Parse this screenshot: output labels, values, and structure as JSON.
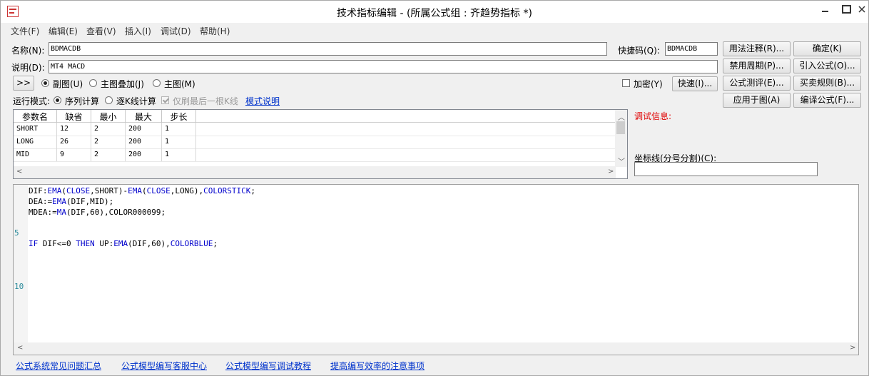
{
  "window": {
    "title": "技术指标编辑 - (所属公式组 : 齐趋势指标 *)"
  },
  "menu": [
    {
      "label": "文件(F)"
    },
    {
      "label": "编辑(E)"
    },
    {
      "label": "查看(V)"
    },
    {
      "label": "插入(I)"
    },
    {
      "label": "调试(D)"
    },
    {
      "label": "帮助(H)"
    }
  ],
  "form": {
    "name_label": "名称(N):",
    "name_value": "BDMACDB",
    "shortcut_label": "快捷码(Q):",
    "shortcut_value": "BDMACDB",
    "desc_label": "说明(D):",
    "desc_value": "MT4 MACD",
    "expand_label": ">>",
    "sub_chart_label": "副图(U)",
    "main_overlay_label": "主图叠加(J)",
    "main_chart_label": "主图(M)",
    "selected_chart": "副图(U)",
    "encrypt_label": "加密(Y)",
    "encrypt_checked": false,
    "fast_button": "快速(I)...",
    "run_mode_label": "运行模式:",
    "seq_calc_label": "序列计算",
    "bar_calc_label": "逐K线计算",
    "selected_mode": "序列计算",
    "last_bar_label": "仅刷最后一根K线",
    "last_bar_checked": true,
    "mode_help_link": "模式说明"
  },
  "buttons": {
    "usage_notes": "用法注释(R)...",
    "ok": "确定(K)",
    "disable_period": "禁用周期(P)...",
    "import_formula": "引入公式(O)...",
    "formula_test": "公式测评(E)...",
    "trade_rules": "买卖规则(B)...",
    "apply_to_chart": "应用于图(A)",
    "compile_formula": "编译公式(F)..."
  },
  "params": {
    "columns": [
      "参数名",
      "缺省",
      "最小",
      "最大",
      "步长"
    ],
    "rows": [
      [
        "SHORT",
        "12",
        "2",
        "200",
        "1"
      ],
      [
        "LONG",
        "26",
        "2",
        "200",
        "1"
      ],
      [
        "MID",
        "9",
        "2",
        "200",
        "1"
      ]
    ]
  },
  "debug": {
    "label": "调试信息:"
  },
  "coord": {
    "label": "坐标线(分号分割)(C):",
    "value": ""
  },
  "editor": {
    "line_numbers": [
      "5",
      "10"
    ],
    "code_lines": [
      "DIF:EMA(CLOSE,SHORT)-EMA(CLOSE,LONG),COLORSTICK;",
      "DEA:=EMA(DIF,MID);",
      "MDEA:=MA(DIF,60),COLOR000099;",
      "",
      "",
      "IF DIF<=0 THEN UP:EMA(DIF,60),COLORBLUE;"
    ]
  },
  "footer_links": [
    {
      "label": "公式系统常见问题汇总"
    },
    {
      "label": "公式模型编写客服中心"
    },
    {
      "label": "公式模型编写调试教程"
    },
    {
      "label": "提高编写效率的注意事项"
    }
  ],
  "colors": {
    "link": "#0033cc",
    "debug_label": "#e00000",
    "keyword": "#0000cc",
    "line_number": "#2a8a9a"
  }
}
